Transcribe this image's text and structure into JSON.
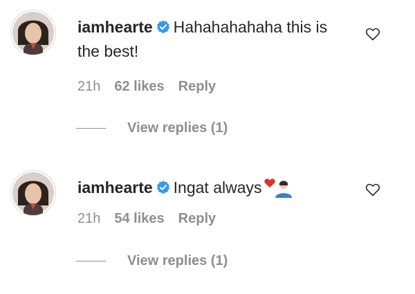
{
  "comments": [
    {
      "username": "iamhearte",
      "text": "Hahahahahaha this is the best!",
      "time": "21h",
      "likes": "62 likes",
      "reply_label": "Reply",
      "view_replies": "View replies (1)"
    },
    {
      "username": "iamhearte",
      "text": "Ingat always",
      "time": "21h",
      "likes": "54 likes",
      "reply_label": "Reply",
      "view_replies": "View replies (1)"
    }
  ],
  "colors": {
    "verified_badge": "#3897f0",
    "muted_text": "#8e8e8e",
    "primary_text": "#262626"
  },
  "icons": {
    "verified": "verified-badge-icon",
    "like": "heart-outline-icon",
    "emoji": "heart-and-person-emoji"
  }
}
